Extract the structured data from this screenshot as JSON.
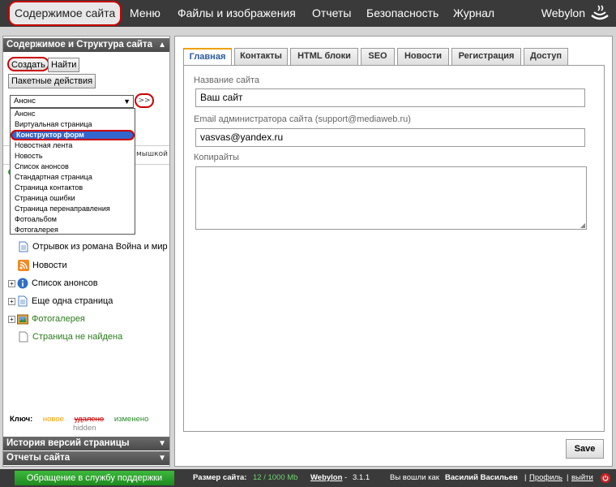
{
  "nav": {
    "items": [
      "Содержимое сайта",
      "Меню",
      "Файлы и изображения",
      "Отчеты",
      "Безопасность",
      "Журнал"
    ],
    "logo": "Webylon"
  },
  "left": {
    "header": "Содержимое и Структура сайта",
    "create_btn": "Создать",
    "find_btn": "Найти",
    "batch_btn": "Пакетные действия",
    "select_value": "Анонс",
    "go_btn": ">>",
    "hidden_fragment": "мышкой",
    "dropdown_options": [
      "Анонс",
      "Виртуальная страница",
      "Конструктор форм",
      "Новостная лента",
      "Новость",
      "Список анонсов",
      "Стандартная страница",
      "Страница контактов",
      "Страница ошибки",
      "Страница перенаправления",
      "Фотоальбом",
      "Фотогалерея"
    ],
    "tree": [
      "Отрывок из романа Война и мир",
      "Новости",
      "Список анонсов",
      "Еще одна страница",
      "Фотогалерея",
      "Страница не найдена"
    ],
    "key_label": "Ключ:",
    "key_new": "новое",
    "key_deleted": "удалено",
    "key_changed": "изменено",
    "key_hidden": "hidden",
    "history_header": "История версий страницы",
    "reports_header": "Отчеты сайта"
  },
  "main": {
    "tabs": [
      "Главная",
      "Контакты",
      "HTML блоки",
      "SEO",
      "Новости",
      "Регистрация",
      "Доступ"
    ],
    "site_name_label": "Название сайта",
    "site_name_value": "Ваш сайт",
    "email_label": "Email администратора сайта (support@mediaweb.ru)",
    "email_value": "vasvas@yandex.ru",
    "copyright_label": "Копирайты",
    "save_btn": "Save"
  },
  "footer": {
    "support_btn": "Обращение в службу поддержки",
    "size_label": "Размер сайта:",
    "size_value": "12 / 1000 Mb",
    "brand": "Webylon",
    "dash": "-",
    "version": "3.1.1",
    "logged_in": "Вы вошли как",
    "user": "Василий Васильев",
    "sep1": "|",
    "profile": "Профиль",
    "sep2": "|",
    "logout": "выйти"
  }
}
